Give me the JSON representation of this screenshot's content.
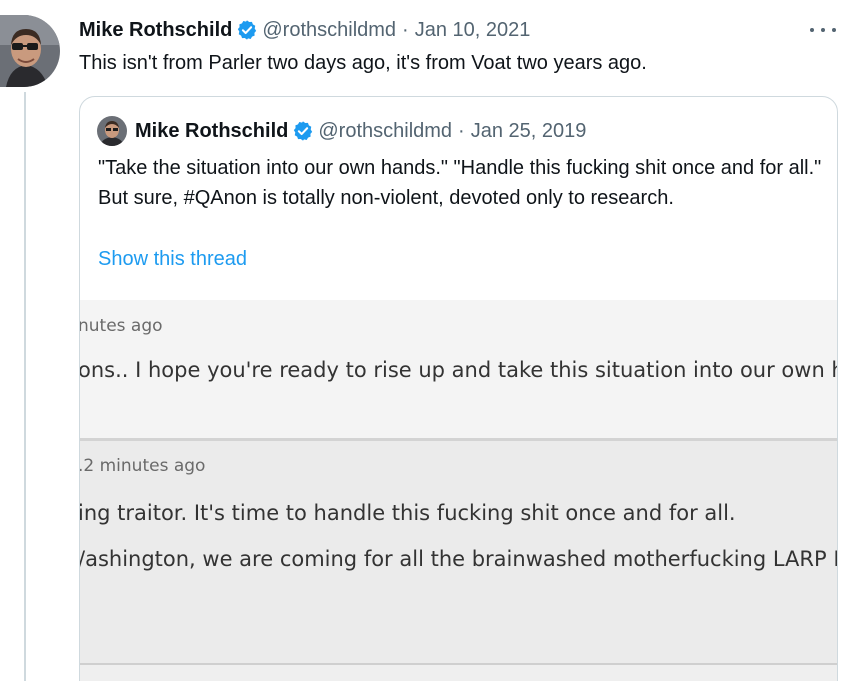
{
  "tweet": {
    "author_name": "Mike Rothschild",
    "handle": "@rothschildmd",
    "separator": "·",
    "date": "Jan 10, 2021",
    "text": "This isn't from Parler two days ago, it's from Voat two years ago.",
    "more_icon": "more-horizontal-icon",
    "verified_icon": "verified-badge-icon"
  },
  "quoted_tweet": {
    "author_name": "Mike Rothschild",
    "handle": "@rothschildmd",
    "separator": "·",
    "date": "Jan 25, 2019",
    "text": "\"Take the situation into our own hands.\" \"Handle this fucking shit once and for all.\" But sure, #QAnon is totally non-violent, devoted only to research.",
    "show_thread": "Show this thread",
    "verified_icon": "verified-badge-icon"
  },
  "screenshot": {
    "post1": {
      "meta": "nutes ago",
      "body": "ons.. I hope you're ready to rise up and take this situation into our own ha"
    },
    "post2": {
      "meta": ".2 minutes ago",
      "line1": "ing traitor. It's time to handle this fucking shit once and for all.",
      "line2": "/ashington, we are coming for all the brainwashed motherfucking LARP L"
    }
  },
  "colors": {
    "link": "#1d9bf0",
    "muted": "#536471",
    "verified": "#1d9bf0",
    "border": "#cfd9de"
  }
}
